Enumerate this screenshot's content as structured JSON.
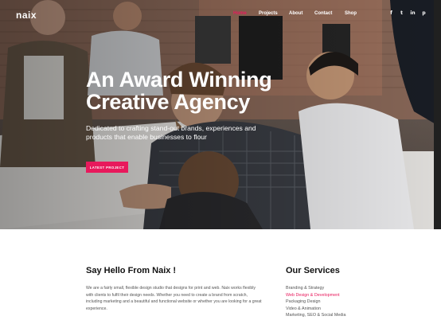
{
  "header": {
    "brand": "naix",
    "nav": [
      {
        "label": "Home",
        "active": true
      },
      {
        "label": "Projects",
        "active": false
      },
      {
        "label": "About",
        "active": false
      },
      {
        "label": "Contact",
        "active": false
      },
      {
        "label": "Shop",
        "active": false
      }
    ],
    "social_icons": [
      "facebook-icon",
      "twitter-icon",
      "linkedin-icon",
      "pinterest-icon"
    ],
    "social_glyphs": [
      "f",
      "t",
      "in",
      "p"
    ]
  },
  "hero": {
    "headline_line1": "An Award Winning",
    "headline_line2": "Creative Agency",
    "tagline": "Dedicated to crafting stand-out brands, experiences and products that enable businesses to flour",
    "cta_label": "LATEST PROJECT"
  },
  "about": {
    "title": "Say Hello From Naix !",
    "text": "We are a fairly small, flexible design studio that designs for print and web. Naix works flexibly with clients to fulfil their design needs. Whether you need to create a brand from scratch, including marketing and a beautiful and functional website or whether you are looking for a great experience."
  },
  "services": {
    "title": "Our Services",
    "items": [
      {
        "label": "Branding & Strategy",
        "active": false
      },
      {
        "label": "Web Design & Development",
        "active": true
      },
      {
        "label": "Packaging Design",
        "active": false
      },
      {
        "label": "Video & Animation",
        "active": false
      },
      {
        "label": "Marketing, SEO & Social Media",
        "active": false
      }
    ]
  },
  "colors": {
    "accent": "#e8195c",
    "text": "#222222",
    "muted": "#555555"
  }
}
